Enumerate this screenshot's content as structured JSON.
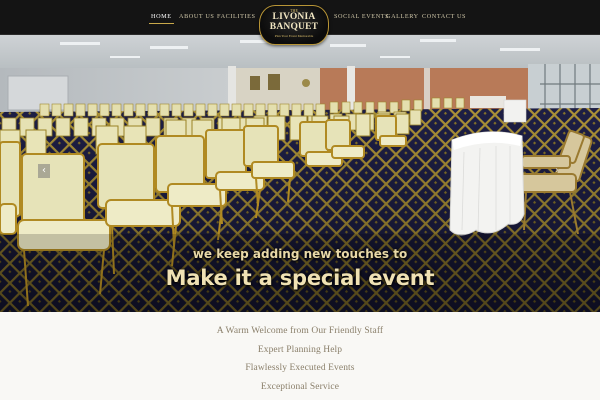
{
  "nav": {
    "left": [
      {
        "label": "HOME",
        "active": true
      },
      {
        "label": "ABOUT US",
        "active": false
      },
      {
        "label": "FACILITIES",
        "active": false
      }
    ],
    "right": [
      {
        "label": "SOCIAL EVENTS",
        "active": false
      },
      {
        "label": "GALLERY",
        "active": false
      },
      {
        "label": "CONTACT US",
        "active": false
      }
    ]
  },
  "logo": {
    "the": "THE",
    "line1": "LIVONIA",
    "line2": "BANQUET",
    "tagline": "Plan Your Event Memorable"
  },
  "hero": {
    "caption_small": "we keep adding new touches to",
    "caption_big": "Make it a special event",
    "prev_icon": "‹",
    "next_icon": "›"
  },
  "services": [
    "A Warm Welcome from Our Friendly Staff",
    "Expert Planning Help",
    "Flawlessly Executed Events",
    "Exceptional Service"
  ],
  "colors": {
    "nav_bg": "#141414",
    "gold": "#c9a94a",
    "chair": "#e6e3b8",
    "carpet": "#1f2048",
    "service_text": "#8a7f6a"
  }
}
